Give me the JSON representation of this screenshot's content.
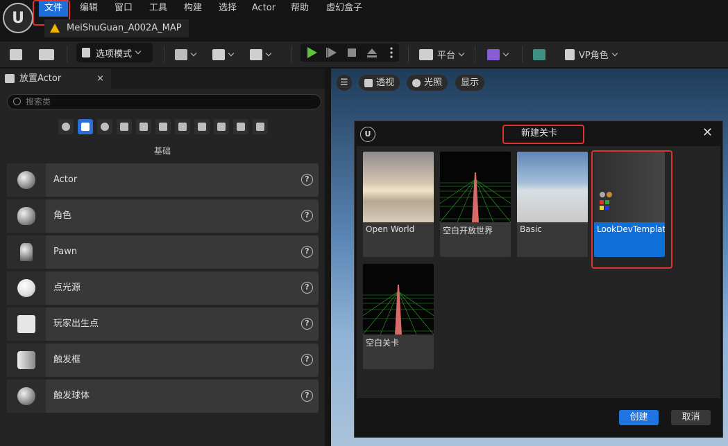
{
  "menu": {
    "items": [
      "文件",
      "编辑",
      "窗口",
      "工具",
      "构建",
      "选择",
      "Actor",
      "帮助",
      "虚幻盒子"
    ],
    "active_index": 0
  },
  "document_tab": {
    "title": "MeiShuGuan_A002A_MAP"
  },
  "toolbar": {
    "mode_label": "选项模式",
    "platform_label": "平台",
    "vp_role_label": "VP角色"
  },
  "place_actor_panel": {
    "tab_label": "放置Actor",
    "close_glyph": "×",
    "search_placeholder": "搜索类",
    "section_title": "基础",
    "items": [
      {
        "label": "Actor",
        "icon": "sphere-icon"
      },
      {
        "label": "角色",
        "icon": "character-icon"
      },
      {
        "label": "Pawn",
        "icon": "pawn-icon"
      },
      {
        "label": "点光源",
        "icon": "point-light-icon"
      },
      {
        "label": "玩家出生点",
        "icon": "player-start-icon"
      },
      {
        "label": "触发框",
        "icon": "trigger-box-icon"
      },
      {
        "label": "触发球体",
        "icon": "trigger-sphere-icon"
      }
    ],
    "help_glyph": "?"
  },
  "viewport": {
    "perspective_label": "透视",
    "lighting_label": "光照",
    "show_label": "显示"
  },
  "new_level_dialog": {
    "title": "新建关卡",
    "close_glyph": "✕",
    "templates": [
      {
        "label": "Open World"
      },
      {
        "label": "空白开放世界"
      },
      {
        "label": "Basic"
      },
      {
        "label": "LookDevTemplate",
        "selected": true
      },
      {
        "label": "空白关卡"
      }
    ],
    "create_label": "创建",
    "cancel_label": "取消"
  },
  "colors": {
    "accent": "#1e74e0",
    "highlight_box": "#e0332f"
  }
}
